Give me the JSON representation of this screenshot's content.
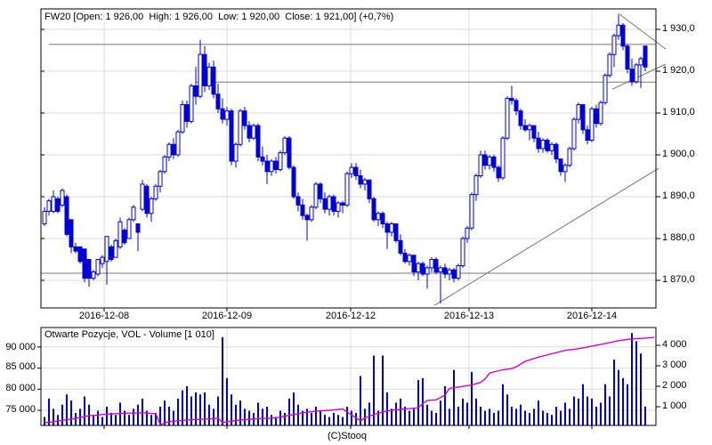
{
  "header": {
    "info_line": "FW20 [Open: 1 926,00  High: 1 926,00  Low: 1 920,00  Close: 1 921,00] (+0,7%)"
  },
  "volume_panel": {
    "title": "Otwarte Pozycje, VOL - Volume [1 010]"
  },
  "footer": {
    "copyright": "(C)Stooq"
  },
  "colors": {
    "candle": "#0000dd",
    "volume_bar": "#0000dd",
    "open_interest": "#d400d4",
    "grid": "#dcdcdc",
    "annotation": "#787878",
    "border": "#000000",
    "text": "#000000",
    "background": "#ffffff"
  },
  "chart_data": {
    "type": "candlestick",
    "instrument": "FW20",
    "last_bar": {
      "open": "1 926,00",
      "high": "1 926,00",
      "low": "1 920,00",
      "close": "1 921,00",
      "change": "+0,7%"
    },
    "price_axis": {
      "side": "right",
      "tick_labels": [
        "1 930,0",
        "1 920,0",
        "1 910,0",
        "1 900,0",
        "1 890,0",
        "1 880,0",
        "1 870,0"
      ],
      "tick_values": [
        1930,
        1920,
        1910,
        1900,
        1890,
        1880,
        1870
      ]
    },
    "x_axis": {
      "tick_labels": [
        "2016-12-08",
        "2016-12-09",
        "2016-12-12",
        "2016-12-13",
        "2016-12-14"
      ],
      "tick_indices": [
        13.4,
        41,
        68.8,
        95.4,
        123
      ]
    },
    "candles": [
      [
        1883.5,
        1887.5,
        1883,
        1886.5
      ],
      [
        1886.5,
        1889.5,
        1885.5,
        1889
      ],
      [
        1886.5,
        1891.5,
        1886,
        1890
      ],
      [
        1889.5,
        1890,
        1886,
        1886.5
      ],
      [
        1888,
        1892,
        1887.5,
        1891.5
      ],
      [
        1890,
        1890.5,
        1880.5,
        1881
      ],
      [
        1884.5,
        1884.5,
        1876.5,
        1878
      ],
      [
        1878,
        1879,
        1876.5,
        1877
      ],
      [
        1878,
        1878,
        1874,
        1874.5
      ],
      [
        1877.5,
        1877.5,
        1869.5,
        1870.5
      ],
      [
        1875,
        1875,
        1868.5,
        1870.5
      ],
      [
        1870.5,
        1872.5,
        1870,
        1872
      ],
      [
        1871.5,
        1875,
        1871,
        1875
      ],
      [
        1874,
        1876,
        1873,
        1875.5
      ],
      [
        1874.5,
        1880.5,
        1869,
        1880.5
      ],
      [
        1878,
        1878.5,
        1874.5,
        1875
      ],
      [
        1875.5,
        1880,
        1875.5,
        1879.5
      ],
      [
        1878,
        1885,
        1877.5,
        1884
      ],
      [
        1882,
        1882.5,
        1878.5,
        1879
      ],
      [
        1880,
        1885,
        1880,
        1884.5
      ],
      [
        1884.5,
        1888,
        1884,
        1887.5
      ],
      [
        1883.5,
        1883.5,
        1877,
        1881.5
      ],
      [
        1887,
        1894,
        1886.5,
        1893
      ],
      [
        1892.5,
        1893,
        1885,
        1886
      ],
      [
        1886,
        1890,
        1884,
        1889.5
      ],
      [
        1889.5,
        1893,
        1889,
        1892.5
      ],
      [
        1892.5,
        1896.5,
        1891,
        1896
      ],
      [
        1896,
        1900,
        1895.5,
        1899.5
      ],
      [
        1899.5,
        1903,
        1898.5,
        1902.5
      ],
      [
        1902.5,
        1904,
        1899,
        1900
      ],
      [
        1900,
        1906,
        1899.5,
        1905.5
      ],
      [
        1905.5,
        1913,
        1905,
        1912
      ],
      [
        1912,
        1913,
        1906.5,
        1908
      ],
      [
        1908,
        1917,
        1907.5,
        1916.5
      ],
      [
        1916.5,
        1921,
        1912,
        1914
      ],
      [
        1914,
        1927.5,
        1913.5,
        1924
      ],
      [
        1924,
        1926,
        1915,
        1916.5
      ],
      [
        1916.5,
        1922,
        1915.5,
        1921
      ],
      [
        1921,
        1922.5,
        1913.5,
        1914.5
      ],
      [
        1914.5,
        1917,
        1910,
        1911
      ],
      [
        1911,
        1913.5,
        1907.5,
        1908.5
      ],
      [
        1908.5,
        1911.5,
        1907,
        1910.5
      ],
      [
        1910.5,
        1911,
        1897.5,
        1898.5
      ],
      [
        1898.5,
        1903,
        1897,
        1902.5
      ],
      [
        1902.5,
        1911,
        1902,
        1910.5
      ],
      [
        1910.5,
        1911.5,
        1906,
        1907
      ],
      [
        1907,
        1908,
        1903,
        1904
      ],
      [
        1904,
        1907.5,
        1903.5,
        1907
      ],
      [
        1907,
        1907.5,
        1898.5,
        1899.5
      ],
      [
        1899.5,
        1902,
        1897.5,
        1898.5
      ],
      [
        1898.5,
        1900,
        1893,
        1896
      ],
      [
        1896,
        1899,
        1895,
        1898.5
      ],
      [
        1898.5,
        1899.5,
        1895.5,
        1896.5
      ],
      [
        1896.5,
        1901,
        1896,
        1900.5
      ],
      [
        1900.5,
        1904.5,
        1900,
        1904
      ],
      [
        1904,
        1904.5,
        1896.5,
        1897
      ],
      [
        1897,
        1897.5,
        1889.5,
        1890
      ],
      [
        1890,
        1891,
        1886.5,
        1888
      ],
      [
        1888,
        1889.5,
        1884.5,
        1885.5
      ],
      [
        1885.5,
        1886,
        1879.5,
        1884.5
      ],
      [
        1884.5,
        1888,
        1884,
        1887.5
      ],
      [
        1887.5,
        1893.5,
        1887,
        1893
      ],
      [
        1893,
        1893.5,
        1888.5,
        1889.5
      ],
      [
        1889.5,
        1891,
        1886,
        1887
      ],
      [
        1887,
        1890.5,
        1885.5,
        1890
      ],
      [
        1890,
        1890.5,
        1885.5,
        1886.5
      ],
      [
        1886.5,
        1889,
        1885,
        1888.5
      ],
      [
        1888.5,
        1889,
        1886,
        1888
      ],
      [
        1888,
        1896,
        1887.5,
        1895.5
      ],
      [
        1895.5,
        1898,
        1894.5,
        1897
      ],
      [
        1897,
        1898,
        1894,
        1895
      ],
      [
        1895,
        1896.5,
        1892,
        1893
      ],
      [
        1893,
        1894.5,
        1891.5,
        1894
      ],
      [
        1894,
        1894,
        1888.5,
        1889.5
      ],
      [
        1889.5,
        1890,
        1884,
        1884.5
      ],
      [
        1884.5,
        1886.5,
        1883,
        1886
      ],
      [
        1886,
        1886.5,
        1882.5,
        1883.5
      ],
      [
        1883.5,
        1884,
        1877.5,
        1881.5
      ],
      [
        1881.5,
        1884,
        1880.5,
        1883.5
      ],
      [
        1883.5,
        1883.5,
        1879,
        1879.5
      ],
      [
        1879.5,
        1881,
        1876,
        1876.5
      ],
      [
        1876.5,
        1877.5,
        1874,
        1874.5
      ],
      [
        1874.5,
        1876.5,
        1873.5,
        1876
      ],
      [
        1876,
        1876,
        1871,
        1872
      ],
      [
        1872,
        1874.5,
        1870,
        1874
      ],
      [
        1874,
        1874.5,
        1871,
        1871.5
      ],
      [
        1871.5,
        1873.5,
        1868,
        1873
      ],
      [
        1873,
        1875.5,
        1872,
        1875
      ],
      [
        1875,
        1875.5,
        1871.5,
        1872
      ],
      [
        1872,
        1873.5,
        1864.5,
        1873
      ],
      [
        1873,
        1874,
        1870.5,
        1871.5
      ],
      [
        1871.5,
        1873,
        1870,
        1872.5
      ],
      [
        1872.5,
        1873,
        1869.5,
        1870.5
      ],
      [
        1870.5,
        1874,
        1870,
        1873.5
      ],
      [
        1873.5,
        1880.5,
        1873,
        1880
      ],
      [
        1880,
        1883,
        1879,
        1882.5
      ],
      [
        1882.5,
        1891,
        1882,
        1890.5
      ],
      [
        1890.5,
        1895.5,
        1889,
        1895
      ],
      [
        1895,
        1901,
        1894.5,
        1900
      ],
      [
        1900,
        1901,
        1896.5,
        1897.5
      ],
      [
        1897.5,
        1900,
        1896.5,
        1899.5
      ],
      [
        1899.5,
        1900,
        1896,
        1897
      ],
      [
        1897,
        1897.5,
        1893.5,
        1894.5
      ],
      [
        1894.5,
        1904.5,
        1894,
        1904
      ],
      [
        1904,
        1914,
        1903.5,
        1913.5
      ],
      [
        1913.5,
        1916.5,
        1912,
        1913
      ],
      [
        1913,
        1913.5,
        1909.5,
        1910.5
      ],
      [
        1910.5,
        1911,
        1906,
        1907
      ],
      [
        1907,
        1908.5,
        1905.5,
        1906
      ],
      [
        1906,
        1907.5,
        1903.5,
        1907
      ],
      [
        1907,
        1907,
        1903,
        1904
      ],
      [
        1904,
        1905.5,
        1900.5,
        1901.5
      ],
      [
        1901.5,
        1904,
        1900.5,
        1903.5
      ],
      [
        1903.5,
        1904,
        1900.5,
        1901
      ],
      [
        1901,
        1903,
        1900,
        1902.5
      ],
      [
        1902.5,
        1903,
        1898,
        1899
      ],
      [
        1899,
        1899,
        1895,
        1896
      ],
      [
        1896,
        1898,
        1893.5,
        1897.5
      ],
      [
        1897.5,
        1902,
        1897,
        1901.5
      ],
      [
        1901.5,
        1909,
        1901,
        1908.5
      ],
      [
        1908.5,
        1912.5,
        1907.5,
        1912
      ],
      [
        1912,
        1912,
        1905,
        1906
      ],
      [
        1906,
        1907,
        1902.5,
        1903.5
      ],
      [
        1903.5,
        1911.5,
        1903,
        1911
      ],
      [
        1911,
        1912,
        1906.5,
        1907.5
      ],
      [
        1907.5,
        1913,
        1907,
        1912.5
      ],
      [
        1912.5,
        1919.5,
        1912,
        1919
      ],
      [
        1919,
        1924.5,
        1918.5,
        1924
      ],
      [
        1924,
        1929,
        1921,
        1928.5
      ],
      [
        1928.5,
        1933.5,
        1927.5,
        1931
      ],
      [
        1931,
        1931.5,
        1925,
        1926
      ],
      [
        1926,
        1926.5,
        1919.5,
        1920.5
      ],
      [
        1920.5,
        1923,
        1916.5,
        1917.5
      ],
      [
        1917.5,
        1922,
        1917,
        1921.5
      ],
      [
        1921.5,
        1923.5,
        1916,
        1923
      ],
      [
        1926,
        1926,
        1920,
        1921
      ]
    ],
    "annotations": {
      "hlines": [
        {
          "price": 1926.4,
          "from_index": 1
        },
        {
          "price": 1917.4,
          "from_index": 34
        },
        {
          "price": 1871.7,
          "from_index": -0.8
        }
      ],
      "trendlines": [
        {
          "i1": 87.6,
          "p1": 1864.0,
          "i2": 138.0,
          "p2": 1896.8
        },
        {
          "i1": 129.0,
          "p1": 1933.8,
          "i2": 139.6,
          "p2": 1925.3
        },
        {
          "i1": 127.6,
          "p1": 1915.7,
          "i2": 139.6,
          "p2": 1921.7
        }
      ]
    },
    "volume": {
      "series_label": "VOL - Volume",
      "last_value": "1 010",
      "left_axis": {
        "tick_labels": [
          "90 000",
          "85 000",
          "80 000",
          "75 000"
        ],
        "tick_values": [
          90000,
          85000,
          80000,
          75000
        ]
      },
      "right_axis": {
        "tick_labels": [
          "4 000",
          "3 000",
          "2 000",
          "1 000"
        ],
        "tick_values": [
          4000,
          3000,
          2000,
          1000
        ]
      },
      "bars": [
        500,
        1400,
        900,
        600,
        1100,
        1600,
        1300,
        700,
        900,
        1500,
        1100,
        600,
        800,
        500,
        1000,
        700,
        600,
        1200,
        800,
        600,
        900,
        1100,
        1400,
        800,
        600,
        700,
        1000,
        1300,
        1000,
        800,
        1400,
        1800,
        2000,
        1500,
        1700,
        1600,
        1700,
        1100,
        900,
        1500,
        4400,
        2400,
        1600,
        1100,
        1300,
        900,
        800,
        700,
        1200,
        900,
        1000,
        600,
        500,
        800,
        700,
        1400,
        1700,
        1100,
        800,
        900,
        700,
        1000,
        800,
        600,
        500,
        700,
        600,
        500,
        1000,
        800,
        700,
        2500,
        900,
        1200,
        3500,
        800,
        3500,
        1700,
        900,
        1200,
        1400,
        1000,
        800,
        900,
        2300,
        2400,
        1100,
        800,
        700,
        1300,
        2000,
        900,
        2800,
        1000,
        1400,
        1200,
        2700,
        1400,
        1000,
        800,
        900,
        700,
        800,
        2100,
        1600,
        1000,
        900,
        1100,
        800,
        700,
        900,
        1300,
        800,
        700,
        600,
        1000,
        800,
        1200,
        900,
        1500,
        1400,
        2100,
        1500,
        1400,
        1000,
        1200,
        2100,
        1500,
        3300,
        2800,
        2400,
        2100,
        4600,
        4200,
        3600,
        1010
      ]
    },
    "open_interest": {
      "series_label": "Otwarte Pozycje",
      "points": [
        [
          0,
          72000
        ],
        [
          2,
          72300
        ],
        [
          6,
          72900
        ],
        [
          10,
          73700
        ],
        [
          14,
          74100
        ],
        [
          18,
          74300
        ],
        [
          22,
          74400
        ],
        [
          25,
          74200
        ],
        [
          26,
          71600
        ],
        [
          28,
          72300
        ],
        [
          32,
          72700
        ],
        [
          36,
          72900
        ],
        [
          39,
          73100
        ],
        [
          40,
          72100
        ],
        [
          43,
          72600
        ],
        [
          48,
          73000
        ],
        [
          52,
          73200
        ],
        [
          55,
          73800
        ],
        [
          58,
          74400
        ],
        [
          61,
          74800
        ],
        [
          64,
          75000
        ],
        [
          67,
          75300
        ],
        [
          70,
          73200
        ],
        [
          71,
          72500
        ],
        [
          72,
          73200
        ],
        [
          74,
          74000
        ],
        [
          76,
          74600
        ],
        [
          78,
          75000
        ],
        [
          81,
          75300
        ],
        [
          84,
          75600
        ],
        [
          85,
          76600
        ],
        [
          86,
          77300
        ],
        [
          88,
          77500
        ],
        [
          89,
          78000
        ],
        [
          90,
          78600
        ],
        [
          91,
          80200
        ],
        [
          93,
          80500
        ],
        [
          96,
          81000
        ],
        [
          98,
          81600
        ],
        [
          99,
          82400
        ],
        [
          100,
          83800
        ],
        [
          101,
          84100
        ],
        [
          103,
          84600
        ],
        [
          105,
          84900
        ],
        [
          106,
          85300
        ],
        [
          108,
          86600
        ],
        [
          111,
          87600
        ],
        [
          114,
          88400
        ],
        [
          117,
          89200
        ],
        [
          120,
          89600
        ],
        [
          123,
          90200
        ],
        [
          126,
          90800
        ],
        [
          129,
          91500
        ],
        [
          131,
          91800
        ],
        [
          133,
          92000
        ],
        [
          135,
          92100
        ],
        [
          137,
          92300
        ]
      ]
    }
  }
}
